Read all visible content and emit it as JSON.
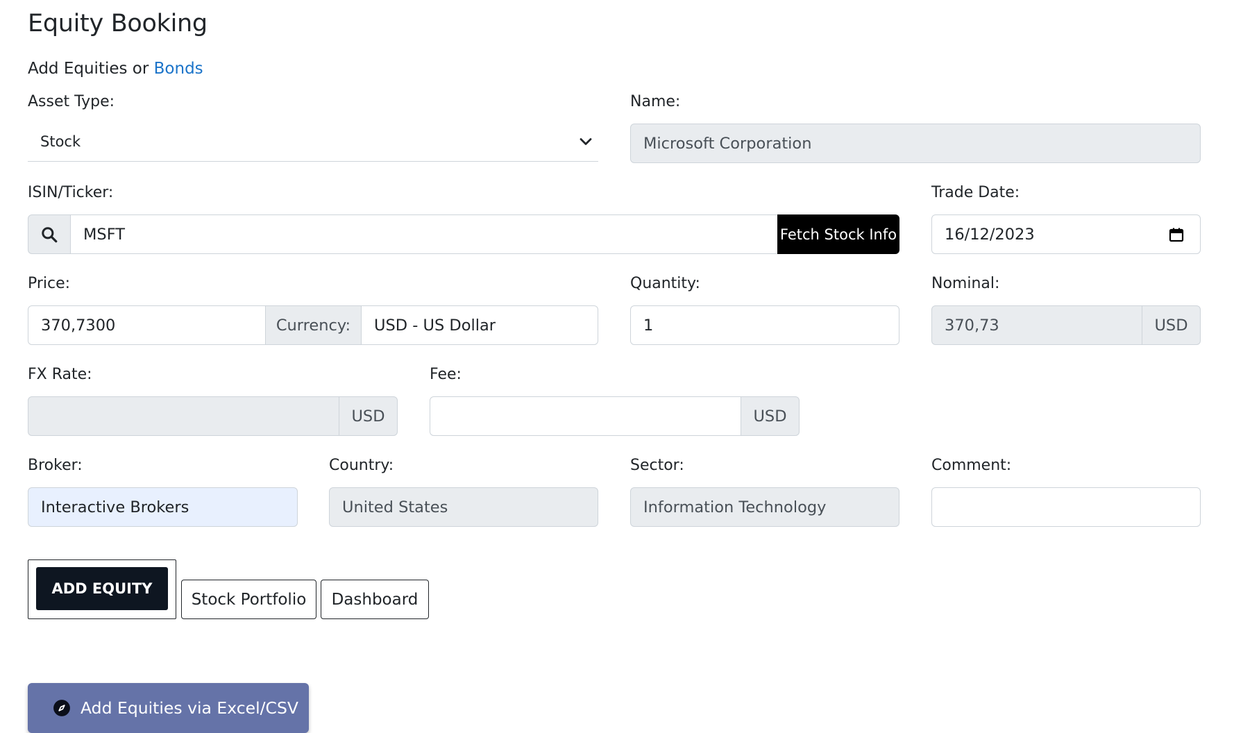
{
  "page": {
    "title": "Equity Booking"
  },
  "subtitle": {
    "prefix": "Add Equities or",
    "link": "Bonds"
  },
  "asset_type": {
    "label": "Asset Type:",
    "value": "Stock"
  },
  "name": {
    "label": "Name:",
    "value": "Microsoft Corporation"
  },
  "isin": {
    "label": "ISIN/Ticker:",
    "value": "MSFT",
    "fetch_label": "Fetch Stock Info"
  },
  "trade_date": {
    "label": "Trade Date:",
    "value": "16/12/2023"
  },
  "price": {
    "label": "Price:",
    "value": "370,7300",
    "currency_label": "Currency:",
    "currency_value": "USD - US Dollar"
  },
  "quantity": {
    "label": "Quantity:",
    "value": "1"
  },
  "nominal": {
    "label": "Nominal:",
    "value": "370,73",
    "unit": "USD"
  },
  "fx_rate": {
    "label": "FX Rate:",
    "value": "",
    "unit": "USD"
  },
  "fee": {
    "label": "Fee:",
    "value": "",
    "unit": "USD"
  },
  "broker": {
    "label": "Broker:",
    "value": "Interactive Brokers"
  },
  "country": {
    "label": "Country:",
    "value": "United States"
  },
  "sector": {
    "label": "Sector:",
    "value": "Information Technology"
  },
  "comment": {
    "label": "Comment:",
    "value": ""
  },
  "actions": {
    "add_equity": "ADD EQUITY",
    "stock_portfolio": "Stock Portfolio",
    "dashboard": "Dashboard",
    "excel_upload": "Add Equities via Excel/CSV"
  },
  "icons": {
    "search": "search-icon",
    "chevron": "chevron-down-icon",
    "calendar": "calendar-icon",
    "upload": "compass-icon"
  }
}
